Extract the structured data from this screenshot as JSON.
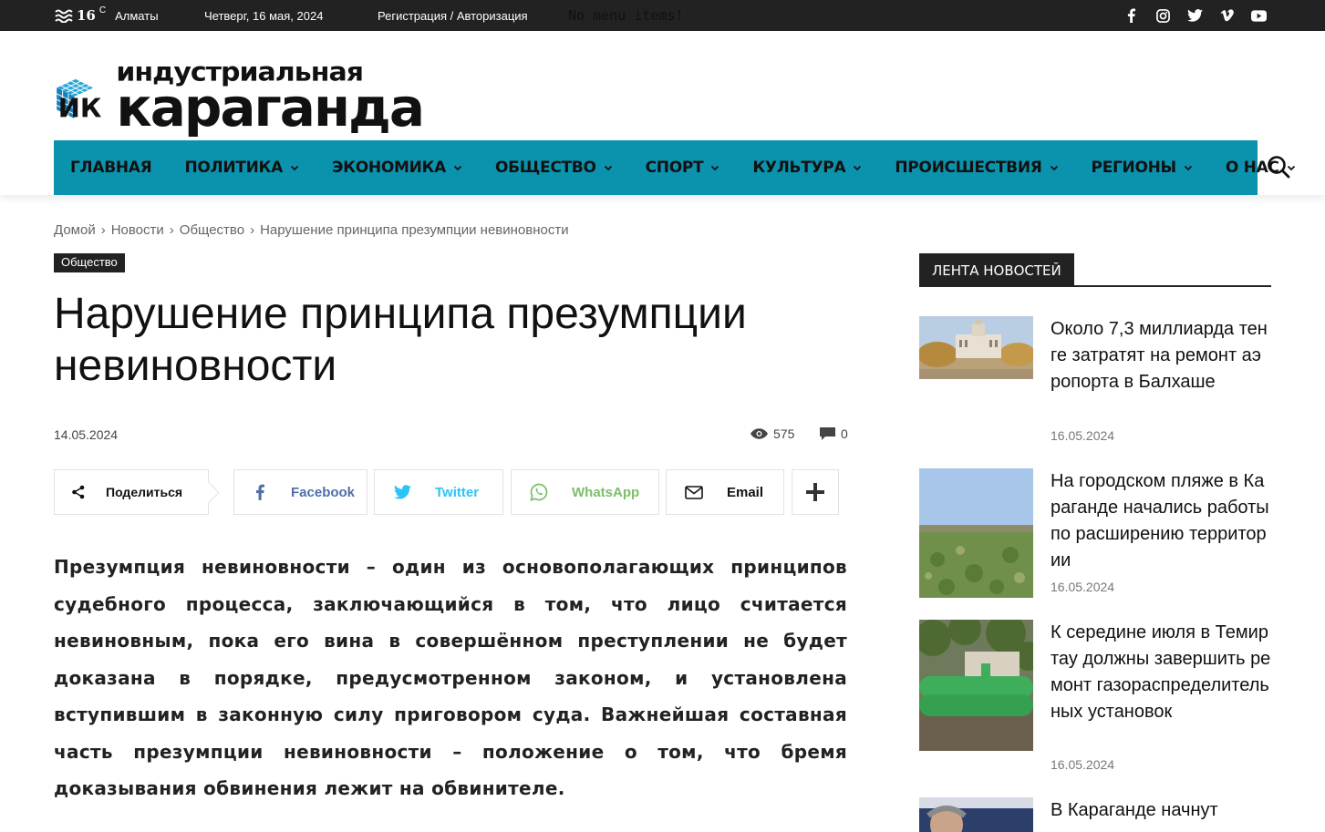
{
  "topbar": {
    "temperature": "16",
    "unit": "C",
    "city": "Алматы",
    "date": "Четверг, 16 мая, 2024",
    "auth": "Регистрация / Авторизация",
    "no_menu": "No menu items!",
    "social": [
      "facebook-icon",
      "instagram-icon",
      "twitter-icon",
      "vimeo-icon",
      "youtube-icon"
    ]
  },
  "logo": {
    "line1": "индустриальная",
    "line2": "караганда"
  },
  "nav": {
    "items": [
      {
        "label": "ГЛАВНАЯ",
        "dropdown": false
      },
      {
        "label": "ПОЛИТИКА",
        "dropdown": true
      },
      {
        "label": "ЭКОНОМИКА",
        "dropdown": true
      },
      {
        "label": "ОБЩЕСТВО",
        "dropdown": true
      },
      {
        "label": "СПОРТ",
        "dropdown": true
      },
      {
        "label": "КУЛЬТУРА",
        "dropdown": true
      },
      {
        "label": "ПРОИСШЕСТВИЯ",
        "dropdown": true
      },
      {
        "label": "РЕГИОНЫ",
        "dropdown": true
      },
      {
        "label": "О НАС",
        "dropdown": true
      }
    ],
    "accent": "#0b93ae"
  },
  "breadcrumb": [
    "Домой",
    "Новости",
    "Общество",
    "Нарушение принципа презумпции невиновности"
  ],
  "article": {
    "category": "Общество",
    "title": "Нарушение принципа презумпции невиновности",
    "date": "14.05.2024",
    "views": "575",
    "comments": "0",
    "body": "Презумпция невиновности – один из основополагающих принципов судебного процесса, заключающийся в том, что лицо считается невиновным, пока его вина в совершённом преступлении не будет доказана в порядке, предусмотренном законом, и установлена вступившим в законную силу приговором суда. Важнейшая составная часть презумпции невиновности – положение о том, что бремя доказывания обвинения лежит на обвинителе."
  },
  "share": {
    "main": "Поделиться",
    "facebook": "Facebook",
    "twitter": "Twitter",
    "whatsapp": "WhatsApp",
    "email": "Email"
  },
  "sidebar": {
    "heading": "ЛЕНТА НОВОСТЕЙ",
    "items": [
      {
        "title": "Около 7,3 миллиарда тенге затратят на ремонт аэропорта в Балхаше",
        "date": "16.05.2024"
      },
      {
        "title": "На городском пляже в Караганде начались работы по расширению территории",
        "date": "16.05.2024"
      },
      {
        "title": "К середине июля в Темиртау должны завершить ремонт газораспределительных установок",
        "date": "16.05.2024"
      },
      {
        "title": "В Караганде начнут",
        "date": ""
      }
    ]
  }
}
